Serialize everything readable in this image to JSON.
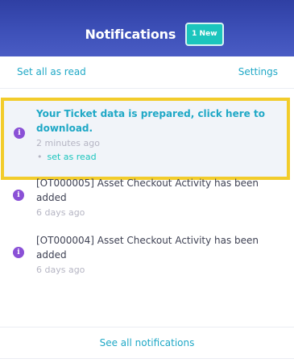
{
  "header": {
    "title": "Notifications",
    "badge": "1 New"
  },
  "actions": {
    "set_all_read": "Set all as read",
    "settings": "Settings"
  },
  "notifications": [
    {
      "title": "Your Ticket data is prepared, click here to download.",
      "time": "2 minutes ago",
      "mark_read": "set as read",
      "unread": true,
      "icon": "info-icon"
    },
    {
      "title": "[OT000005] Asset Checkout Activity has been added",
      "time": "6 days ago",
      "unread": false,
      "icon": "info-icon"
    },
    {
      "title": "[OT000004] Asset Checkout Activity has been added",
      "time": "6 days ago",
      "unread": false,
      "icon": "info-icon"
    }
  ],
  "footer": {
    "see_all": "See all notifications"
  },
  "colors": {
    "header_blue": "#3d50b8",
    "accent_teal": "#1bc5bd",
    "link_blue": "#1fa8c6",
    "highlight_border": "#f2cc2b",
    "icon_purple": "#8a50d6"
  }
}
